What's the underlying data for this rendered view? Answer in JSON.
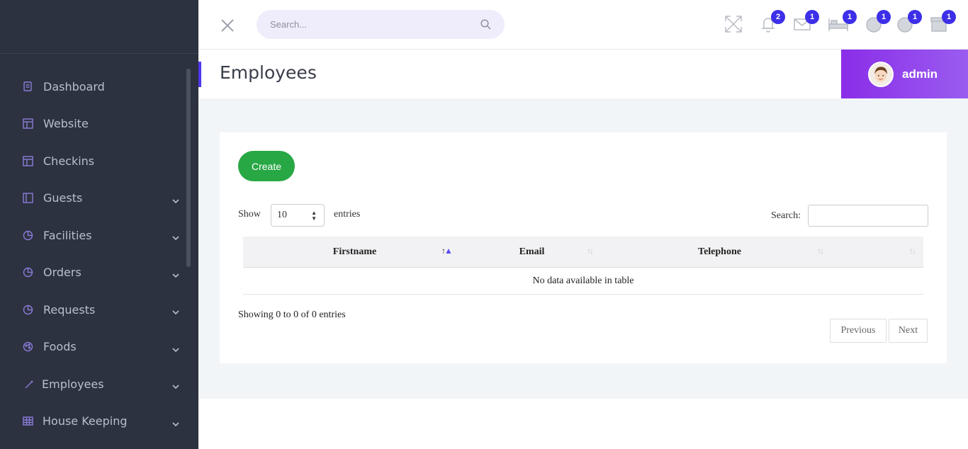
{
  "sidebar": {
    "items": [
      {
        "label": "Dashboard",
        "icon": "dashboard-icon",
        "has_children": false
      },
      {
        "label": "Website",
        "icon": "website-icon",
        "has_children": false
      },
      {
        "label": "Checkins",
        "icon": "checkins-icon",
        "has_children": false
      },
      {
        "label": "Guests",
        "icon": "guests-icon",
        "has_children": true
      },
      {
        "label": "Facilities",
        "icon": "facilities-icon",
        "has_children": true
      },
      {
        "label": "Orders",
        "icon": "orders-icon",
        "has_children": true
      },
      {
        "label": "Requests",
        "icon": "requests-icon",
        "has_children": true
      },
      {
        "label": "Foods",
        "icon": "foods-icon",
        "has_children": true
      },
      {
        "label": "Employees",
        "icon": "employees-icon",
        "has_children": true
      },
      {
        "label": "House Keeping",
        "icon": "housekeeping-icon",
        "has_children": true
      }
    ]
  },
  "header": {
    "search_placeholder": "Search...",
    "icons": [
      {
        "name": "fullscreen-icon",
        "badge": ""
      },
      {
        "name": "bell-icon",
        "badge": "2"
      },
      {
        "name": "mail-icon",
        "badge": "1"
      },
      {
        "name": "bed-icon",
        "badge": "1"
      },
      {
        "name": "moon-icon",
        "badge": "1"
      },
      {
        "name": "user-circle-icon",
        "badge": "1"
      },
      {
        "name": "box-icon",
        "badge": "1"
      }
    ]
  },
  "page": {
    "title": "Employees",
    "user_name": "admin"
  },
  "content": {
    "create_label": "Create",
    "show_label": "Show",
    "entries_value": "10",
    "entries_label": "entries",
    "search_label": "Search:",
    "columns": [
      "Firstname",
      "Email",
      "Telephone",
      ""
    ],
    "empty_message": "No data available in table",
    "info": "Showing 0 to 0 of 0 entries",
    "previous_label": "Previous",
    "next_label": "Next"
  },
  "colors": {
    "sidebar_bg": "#2c323f",
    "accent": "#4e37f0",
    "badge": "#3d2fe8",
    "create_button": "#28a745",
    "admin_gradient_start": "#8a2de8"
  }
}
